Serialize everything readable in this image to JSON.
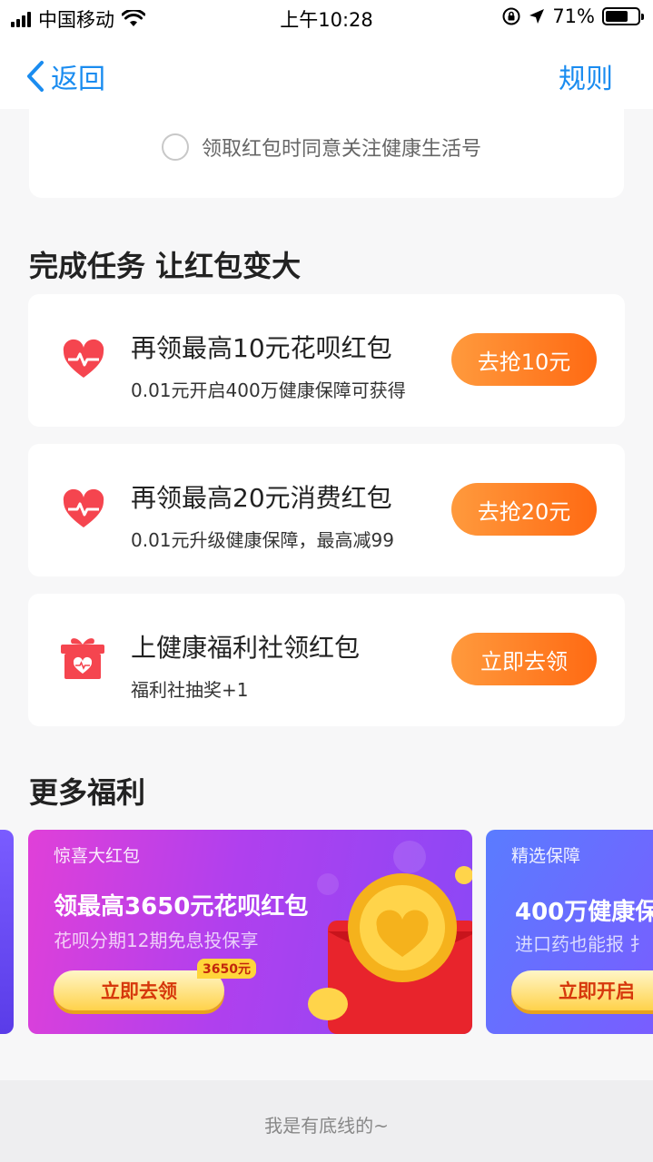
{
  "status": {
    "carrier": "中国移动",
    "time": "上午10:28",
    "battery": "71%",
    "battery_level": 0.71
  },
  "nav": {
    "back": "返回",
    "rules": "规则"
  },
  "agree": {
    "text": "领取红包时同意关注健康生活号"
  },
  "tasks_section": {
    "title": "完成任务 让红包变大"
  },
  "tasks": [
    {
      "title": "再领最高10元花呗红包",
      "sub": "0.01元开启400万健康保障可获得",
      "button": "去抢10元",
      "icon": "heart-pulse-icon"
    },
    {
      "title": "再领最高20元消费红包",
      "sub": "0.01元升级健康保障，最高减99",
      "button": "去抢20元",
      "icon": "heart-pulse-icon"
    },
    {
      "title": "上健康福利社领红包",
      "sub": "福利社抽奖+1",
      "button": "立即去领",
      "icon": "gift-box-icon"
    }
  ],
  "more_section": {
    "title": "更多福利"
  },
  "banners": [
    {
      "tag": "惊喜大红包",
      "title": "领最高3650元花呗红包",
      "sub": "花呗分期12期免息投保享",
      "button": "立即去领",
      "badge": "3650元"
    },
    {
      "tag": "精选保障",
      "title": "400万健康保",
      "sub": "进口药也能报 扌",
      "button": "立即开启"
    }
  ],
  "footer": {
    "text": "我是有底线的~"
  },
  "colors": {
    "accent_blue": "#1a8cf0",
    "button_orange": "#ff6a13",
    "heart_red": "#f5454f"
  }
}
